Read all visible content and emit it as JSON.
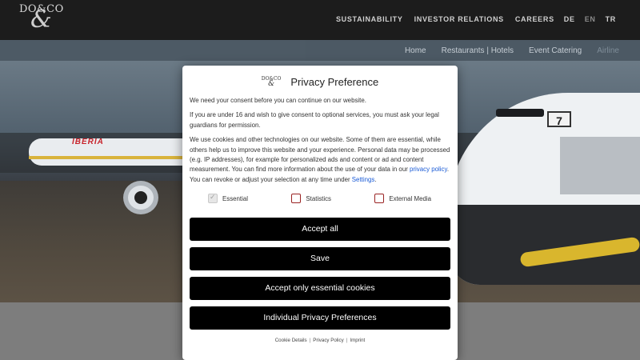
{
  "header": {
    "logo_top": "DO&CO",
    "logo_amp": "&",
    "nav": [
      "SUSTAINABILITY",
      "INVESTOR RELATIONS",
      "CAREERS"
    ],
    "languages": [
      "DE",
      "EN",
      "TR"
    ],
    "active_language": "EN"
  },
  "subnav": [
    "Home",
    "Restaurants | Hotels",
    "Event Catering",
    "Airline"
  ],
  "hero": {
    "airline_text": "IBERIA",
    "gate_number": "7"
  },
  "modal": {
    "logo_small": "DO&CO",
    "title": "Privacy Preference",
    "p1": "We need your consent before you can continue on our website.",
    "p2": "If you are under 16 and wish to give consent to optional services, you must ask your legal guardians for permission.",
    "p3_a": "We use cookies and other technologies on our website. Some of them are essential, while others help us to improve this website and your experience. Personal data may be processed (e.g. IP addresses), for example for personalized ads and content or ad and content measurement. You can find more information about the use of your data in our ",
    "p3_link1": "privacy policy",
    "p3_b": ". You can revoke or adjust your selection at any time under ",
    "p3_link2": "Settings",
    "p3_c": ".",
    "checkboxes": [
      {
        "label": "Essential",
        "checked": true,
        "disabled": true
      },
      {
        "label": "Statistics",
        "checked": false,
        "disabled": false
      },
      {
        "label": "External Media",
        "checked": false,
        "disabled": false
      }
    ],
    "buttons": {
      "accept_all": "Accept all",
      "save": "Save",
      "accept_essential": "Accept only essential cookies",
      "individual": "Individual Privacy Preferences"
    },
    "footer_links": [
      "Cookie Details",
      "Privacy Policy",
      "Imprint"
    ],
    "footer_sep": "|"
  },
  "colors": {
    "header_bg": "#1c1c1c",
    "subnav_bg": "#4b5864",
    "button_bg": "#000000",
    "link": "#1a5bd6",
    "checkbox_border": "#9a2323"
  }
}
